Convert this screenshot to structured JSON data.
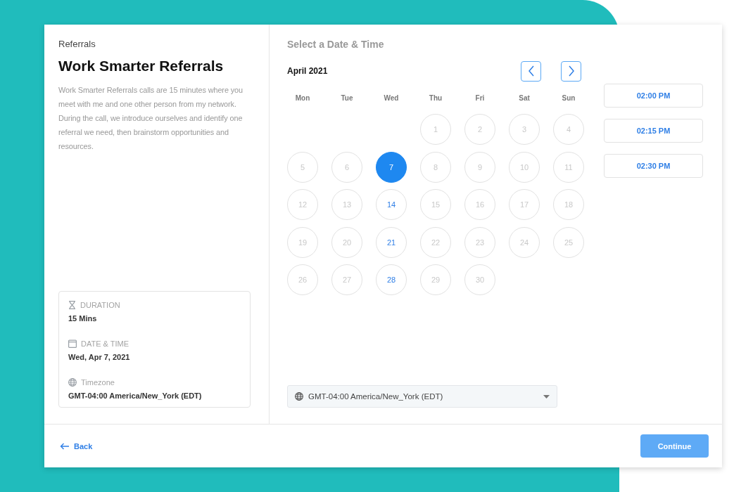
{
  "details": {
    "category": "Referrals",
    "title": "Work Smarter Referrals",
    "description": "Work Smarter Referrals calls are 15 minutes where you meet with me and one other person from my network. During the call, we introduce ourselves and identify one referral we need, then brainstorm opportunities and resources.",
    "summary": [
      {
        "kind": "duration",
        "label": "DURATION",
        "value": "15 Mins"
      },
      {
        "kind": "date",
        "label": "DATE & TIME",
        "value": "Wed, Apr 7, 2021"
      },
      {
        "kind": "timezone",
        "label": "Timezone",
        "value": "GMT-04:00 America/New_York (EDT)"
      }
    ]
  },
  "scheduler": {
    "heading": "Select a Date & Time",
    "month": "April 2021",
    "weekdays": [
      "Mon",
      "Tue",
      "Wed",
      "Thu",
      "Fri",
      "Sat",
      "Sun"
    ],
    "weeks": [
      {
        "days": [
          {
            "label": "1",
            "available": false,
            "selected": false
          },
          {
            "label": "2",
            "available": false,
            "selected": false
          },
          {
            "label": "3",
            "available": false,
            "selected": false
          },
          {
            "label": "4",
            "available": false,
            "selected": false
          }
        ]
      },
      {
        "days": [
          {
            "label": "5",
            "available": false,
            "selected": false
          },
          {
            "label": "6",
            "available": false,
            "selected": false
          },
          {
            "label": "7",
            "available": true,
            "selected": true
          },
          {
            "label": "8",
            "available": false,
            "selected": false
          },
          {
            "label": "9",
            "available": false,
            "selected": false
          },
          {
            "label": "10",
            "available": false,
            "selected": false
          },
          {
            "label": "11",
            "available": false,
            "selected": false
          }
        ]
      },
      {
        "days": [
          {
            "label": "12",
            "available": false,
            "selected": false
          },
          {
            "label": "13",
            "available": false,
            "selected": false
          },
          {
            "label": "14",
            "available": true,
            "selected": false
          },
          {
            "label": "15",
            "available": false,
            "selected": false
          },
          {
            "label": "16",
            "available": false,
            "selected": false
          },
          {
            "label": "17",
            "available": false,
            "selected": false
          },
          {
            "label": "18",
            "available": false,
            "selected": false
          }
        ]
      },
      {
        "days": [
          {
            "label": "19",
            "available": false,
            "selected": false
          },
          {
            "label": "20",
            "available": false,
            "selected": false
          },
          {
            "label": "21",
            "available": true,
            "selected": false
          },
          {
            "label": "22",
            "available": false,
            "selected": false
          },
          {
            "label": "23",
            "available": false,
            "selected": false
          },
          {
            "label": "24",
            "available": false,
            "selected": false
          },
          {
            "label": "25",
            "available": false,
            "selected": false
          }
        ]
      },
      {
        "days": [
          {
            "label": "26",
            "available": false,
            "selected": false
          },
          {
            "label": "27",
            "available": false,
            "selected": false
          },
          {
            "label": "28",
            "available": true,
            "selected": false
          },
          {
            "label": "29",
            "available": false,
            "selected": false
          },
          {
            "label": "30",
            "available": false,
            "selected": false
          }
        ]
      }
    ],
    "times": [
      "02:00 PM",
      "02:15 PM",
      "02:30 PM"
    ],
    "timezone": "GMT-04:00 America/New_York (EDT)"
  },
  "footer": {
    "back": "Back",
    "continue": "Continue",
    "continue_disabled": true
  }
}
